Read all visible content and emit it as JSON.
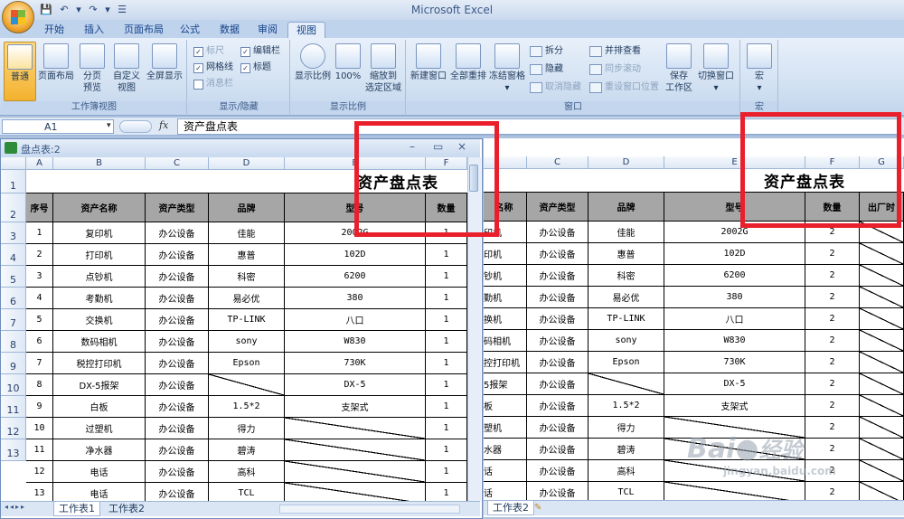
{
  "app": {
    "title": "Microsoft Excel",
    "tabs": [
      "开始",
      "插入",
      "页面布局",
      "公式",
      "数据",
      "审阅",
      "视图"
    ],
    "active_tab": "视图"
  },
  "ribbon": {
    "workbook_views": {
      "label": "工作簿视图",
      "normal": "普通",
      "page_layout": "页面布局",
      "page_break_1": "分页",
      "page_break_2": "预览",
      "custom_1": "自定义",
      "custom_2": "视图",
      "fullscreen": "全屏显示"
    },
    "show_hide": {
      "label": "显示/隐藏",
      "ruler": "标尺",
      "gridlines": "网格线",
      "message_bar": "消息栏",
      "formula_bar": "编辑栏",
      "headings": "标题"
    },
    "zoom": {
      "label": "显示比例",
      "zoom": "显示比例",
      "hundred": "100%",
      "fit_1": "缩放到",
      "fit_2": "选定区域"
    },
    "window": {
      "label": "窗口",
      "new_window": "新建窗口",
      "arrange_all": "全部重排",
      "freeze": "冻结窗格",
      "split": "拆分",
      "hide": "隐藏",
      "unhide": "取消隐藏",
      "side_by_side": "并排查看",
      "sync_scroll": "同步滚动",
      "reset_position": "重设窗口位置",
      "save_ws_1": "保存",
      "save_ws_2": "工作区",
      "switch": "切换窗口"
    },
    "macros": {
      "label": "宏",
      "macros": "宏"
    }
  },
  "formula_bar": {
    "name_box": "A1",
    "fx": "fx",
    "content": "资产盘点表"
  },
  "left_window": {
    "title": "盘点表:2",
    "cols": [
      "A",
      "B",
      "C",
      "D",
      "E",
      "F"
    ],
    "sheet_tabs": [
      "工作表1",
      "工作表2"
    ]
  },
  "right_window": {
    "cols": [
      "C",
      "D",
      "E",
      "F",
      "G"
    ],
    "sheet_tabs": [
      "工作表2"
    ]
  },
  "sheet": {
    "title": "资产盘点表",
    "headers": [
      "序号",
      "资产名称",
      "资产类型",
      "品牌",
      "型号",
      "数量",
      "出厂时"
    ],
    "right_b_partial": "名称",
    "rows": [
      {
        "n": "1",
        "name": "复印机",
        "rname": "印机",
        "type": "办公设备",
        "brand": "佳能",
        "model": "2002G",
        "qty": "1",
        "rqty": "2"
      },
      {
        "n": "2",
        "name": "打印机",
        "rname": "印机",
        "type": "办公设备",
        "brand": "惠普",
        "model": "102D",
        "qty": "1",
        "rqty": "2"
      },
      {
        "n": "3",
        "name": "点钞机",
        "rname": "钞机",
        "type": "办公设备",
        "brand": "科密",
        "model": "6200",
        "qty": "1",
        "rqty": "2"
      },
      {
        "n": "4",
        "name": "考勤机",
        "rname": "勤机",
        "type": "办公设备",
        "brand": "易必优",
        "model": "380",
        "qty": "1",
        "rqty": "2"
      },
      {
        "n": "5",
        "name": "交换机",
        "rname": "换机",
        "type": "办公设备",
        "brand": "TP-LINK",
        "model": "八口",
        "qty": "1",
        "rqty": "2"
      },
      {
        "n": "6",
        "name": "数码相机",
        "rname": "码相机",
        "type": "办公设备",
        "brand": "sony",
        "model": "W830",
        "qty": "1",
        "rqty": "2"
      },
      {
        "n": "7",
        "name": "税控打印机",
        "rname": "控打印机",
        "type": "办公设备",
        "brand": "Epson",
        "model": "730K",
        "qty": "1",
        "rqty": "2"
      },
      {
        "n": "8",
        "name": "DX-5报架",
        "rname": "5报架",
        "type": "办公设备",
        "brand": "",
        "model": "DX-5",
        "qty": "1",
        "rqty": "2"
      },
      {
        "n": "9",
        "name": "白板",
        "rname": "板",
        "type": "办公设备",
        "brand": "1.5*2",
        "model": "支架式",
        "qty": "1",
        "rqty": "2"
      },
      {
        "n": "10",
        "name": "过塑机",
        "rname": "塑机",
        "type": "办公设备",
        "brand": "得力",
        "model": "",
        "qty": "1",
        "rqty": "2"
      },
      {
        "n": "11",
        "name": "净水器",
        "rname": "水器",
        "type": "办公设备",
        "brand": "碧涛",
        "model": "",
        "qty": "1",
        "rqty": "2"
      },
      {
        "n": "12",
        "name": "电话",
        "rname": "话",
        "type": "办公设备",
        "brand": "高科",
        "model": "",
        "qty": "1",
        "rqty": "2"
      },
      {
        "n": "13",
        "name": "电话",
        "rname": "话",
        "type": "办公设备",
        "brand": "TCL",
        "model": "",
        "qty": "1",
        "rqty": "2"
      }
    ],
    "row_numbers": [
      "1",
      "2",
      "3",
      "4",
      "5",
      "6",
      "7",
      "8",
      "9",
      "10",
      "11",
      "12",
      "13"
    ]
  },
  "watermark": {
    "brand": "Bai",
    "brand_cn": "经验",
    "url": "jingyan.baidu.com"
  },
  "colors": {
    "highlight_red": "#ea1f2c",
    "header_gray": "#a6a6a6",
    "ribbon_blue": "#cfdff1"
  }
}
